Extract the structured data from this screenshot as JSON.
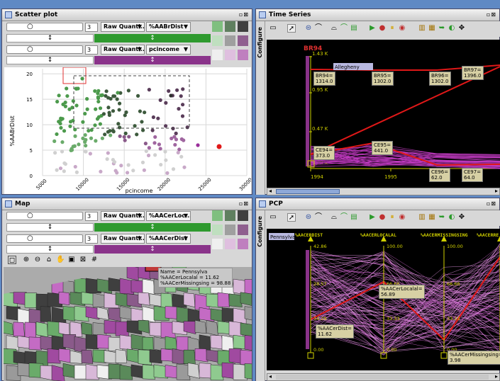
{
  "scatter": {
    "title": "Scatter plot",
    "row1": {
      "num": "3",
      "mode": "Raw Quanti...",
      "var": "%AABrDist",
      "bar_color": "#2f9a2f"
    },
    "row2": {
      "num": "3",
      "mode": "Raw Quanti...",
      "var": "pcincome",
      "bar_color": "#8a338a"
    },
    "chart": {
      "xlabel": "pcincome",
      "ylabel": "%AABrDist",
      "xticks": [
        "5000",
        "10000",
        "15000",
        "20000",
        "25000",
        "30000"
      ],
      "yticks": [
        "0",
        "5",
        "10",
        "15",
        "20"
      ]
    }
  },
  "timeseries": {
    "title": "Time Series",
    "side_label": "Configure",
    "series_label": "BR94",
    "legend": "Allegheny",
    "yticks": [
      "1.43 K",
      "0.95 K",
      "0.47 K",
      "0.00 K"
    ],
    "xticks": [
      "1994",
      "1995"
    ],
    "labels": [
      "BR94=\n1314.0",
      "BR95=\n1302.0",
      "BR96=\n1302.0",
      "BR97=\n1396.0",
      "CE94=\n373.0",
      "CE95=\n441.0",
      "CE96=\n62.0",
      "CE97=\n64.0"
    ]
  },
  "map": {
    "title": "Map",
    "row1": {
      "num": "3",
      "mode": "Raw Quanti...",
      "var": "%AACerLoc...",
      "bar_color": "#2f9a2f"
    },
    "row2": {
      "num": "3",
      "mode": "Raw Quanti...",
      "var": "%AACerDist",
      "bar_color": "#8a338a"
    },
    "tooltip": "Name = Pennsylva\n%AACerLocalal = 11.62\n%AACerMissingsing = 98.88"
  },
  "pcp": {
    "title": "PCP",
    "side_label": "Configure",
    "legend": "Pennsylva",
    "axes": [
      "%AACERDIST",
      "%AACERLOCALAL",
      "%AACERMISSINGSING",
      "%AACERRE"
    ],
    "axis1_ticks": [
      "42.86",
      "28.57",
      "14.29",
      "0.00"
    ],
    "axis2_ticks": [
      "100.00",
      "66.66",
      "33.33",
      "0.00"
    ],
    "axis3_ticks": [
      "100.00",
      "66.66",
      "33.33",
      "0.00"
    ],
    "labels": [
      "%AACerLocalal=\n56.89",
      "%AACerDist=\n11.62",
      "%AACerMissingsing=\n3.98"
    ]
  }
}
